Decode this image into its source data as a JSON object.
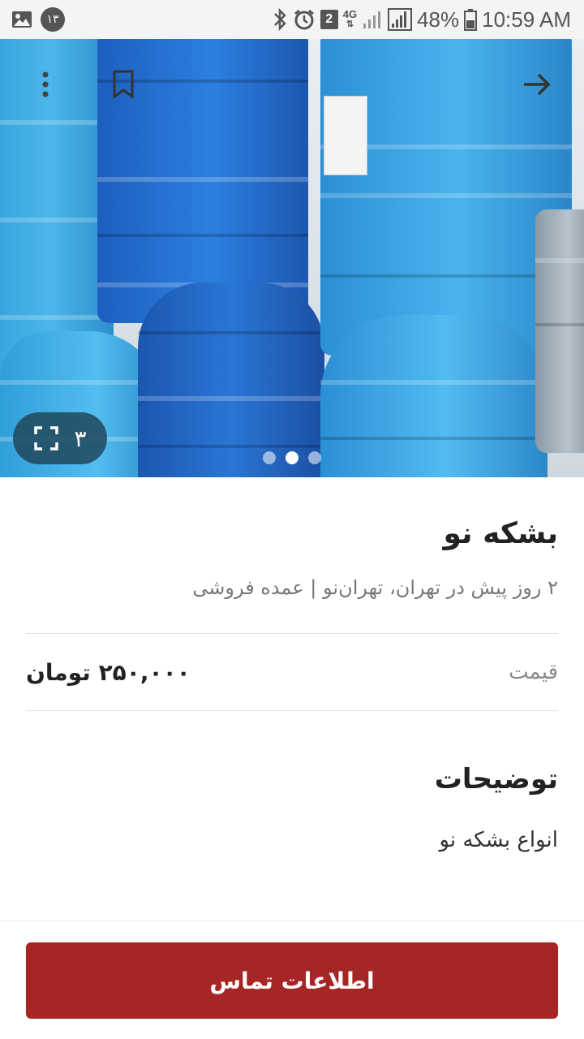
{
  "status_bar": {
    "notification_count": "۱۳",
    "sim_slot": "2",
    "network_type": "4G",
    "battery": "48%",
    "time": "10:59 AM",
    "icons": [
      "image-icon",
      "bluetooth-icon",
      "alarm-icon",
      "signal-icon",
      "battery-icon"
    ]
  },
  "gallery": {
    "image_count": "۳",
    "total_images": 3,
    "active_index": 1,
    "icons": [
      "more-vert-icon",
      "bookmark-icon",
      "back-arrow-icon",
      "fullscreen-icon"
    ]
  },
  "listing": {
    "title": "بشکه نو",
    "meta": "۲ روز پیش در تهران، تهران‌نو | عمده فروشی",
    "price_label": "قیمت",
    "price_value": "۲۵۰,۰۰۰ تومان",
    "description_heading": "توضیحات",
    "description": "انواع بشکه نو"
  },
  "actions": {
    "contact_label": "اطلاعات تماس"
  }
}
